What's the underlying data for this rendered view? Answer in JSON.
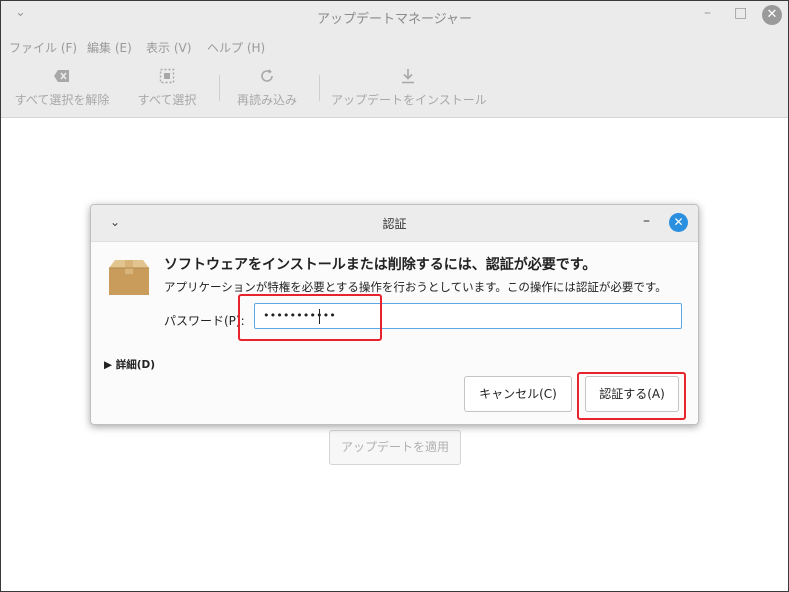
{
  "window": {
    "title": "アップデートマネージャー",
    "chevron_icon": "chevron-down-icon",
    "minimize_glyph": "–",
    "maximize_glyph": "□",
    "close_glyph": "✕"
  },
  "menu": {
    "file": "ファイル (F)",
    "edit": "編集 (E)",
    "view": "表示 (V)",
    "help": "ヘルプ (H)"
  },
  "toolbar": {
    "clear_selection": "すべて選択を解除",
    "select_all": "すべて選択",
    "reload": "再読み込み",
    "install_updates": "アップデートをインストール"
  },
  "main": {
    "apply_button": "アップデートを適用"
  },
  "dialog": {
    "title": "認証",
    "minimize_glyph": "–",
    "close_glyph": "✕",
    "heading": "ソフトウェアをインストールまたは削除するには、認証が必要です。",
    "description": "アプリケーションが特権を必要とする操作を行おうとしています。この操作には認証が必要です。",
    "password_label": "パスワード(P):",
    "password_value": "•••••••••••",
    "details_label": "詳細(D)",
    "cancel_button": "キャンセル(C)",
    "authenticate_button": "認証する(A)"
  },
  "colors": {
    "accent": "#2b8fe0",
    "highlight": "#e8232e",
    "disabled_text": "#a8a8a8"
  }
}
